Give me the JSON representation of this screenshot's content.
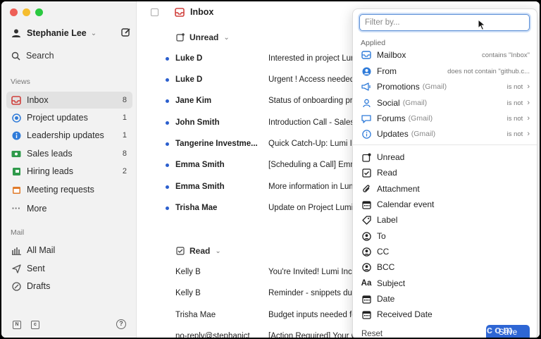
{
  "sidebar": {
    "user_name": "Stephanie Lee",
    "search_label": "Search",
    "views_label": "Views",
    "views": [
      {
        "label": "Inbox",
        "count": "8",
        "icon": "inbox-icon",
        "color": "#d0413d"
      },
      {
        "label": "Project updates",
        "count": "1",
        "icon": "target-icon",
        "color": "#2f7bd9"
      },
      {
        "label": "Leadership updates",
        "count": "1",
        "icon": "info-icon",
        "color": "#2f7bd9"
      },
      {
        "label": "Sales leads",
        "count": "8",
        "icon": "money-icon",
        "color": "#2f9a4b"
      },
      {
        "label": "Hiring leads",
        "count": "2",
        "icon": "flag-icon",
        "color": "#2f9a4b"
      },
      {
        "label": "Meeting requests",
        "count": "",
        "icon": "calendar-icon",
        "color": "#e07b2a"
      },
      {
        "label": "More",
        "count": "",
        "icon": "more-icon",
        "color": "#666666"
      }
    ],
    "mail_label": "Mail",
    "mail": [
      {
        "label": "All Mail",
        "icon": "all-mail-icon"
      },
      {
        "label": "Sent",
        "icon": "send-icon"
      },
      {
        "label": "Drafts",
        "icon": "drafts-icon"
      }
    ]
  },
  "main": {
    "title": "Inbox",
    "unread_group": "Unread",
    "read_group": "Read",
    "unread_rows": [
      {
        "from": "Luke D",
        "subject": "Interested in project Lumi"
      },
      {
        "from": "Luke D",
        "subject": "Urgent ! Access needed"
      },
      {
        "from": "Jane Kim",
        "subject": "Status of onboarding program"
      },
      {
        "from": "John Smith",
        "subject": "Introduction Call - Sales"
      },
      {
        "from": "Tangerine Investme...",
        "subject": "Quick Catch-Up: Lumi Inv"
      },
      {
        "from": "Emma Smith",
        "subject": "[Scheduling a Call] Emma"
      },
      {
        "from": "Emma Smith",
        "subject": "More information in Lumi"
      },
      {
        "from": "Trisha Mae",
        "subject": "Update on Project Lumi"
      }
    ],
    "read_rows": [
      {
        "from": "Kelly B",
        "subject": "You're Invited! Lumi Inc. E"
      },
      {
        "from": "Kelly B",
        "subject": "Reminder - snippets due"
      },
      {
        "from": "Trisha Mae",
        "subject": "Budget inputs needed for"
      },
      {
        "from": "no-reply@stephanict",
        "subject": "[Action Required] Your C"
      }
    ]
  },
  "filter": {
    "placeholder": "Filter by...",
    "applied_label": "Applied",
    "applied": [
      {
        "label": "Mailbox",
        "sub": "",
        "cond": "contains \"Inbox\"",
        "icon": "mailbox-icon",
        "arrow": false
      },
      {
        "label": "From",
        "sub": "",
        "cond": "does not contain \"github.c...",
        "icon": "person-circle-icon",
        "arrow": false
      },
      {
        "label": "Promotions",
        "sub": "(Gmail)",
        "cond": "is not",
        "icon": "megaphone-icon",
        "arrow": true
      },
      {
        "label": "Social",
        "sub": "(Gmail)",
        "cond": "is not",
        "icon": "people-icon",
        "arrow": true
      },
      {
        "label": "Forums",
        "sub": "(Gmail)",
        "cond": "is not",
        "icon": "chat-icon",
        "arrow": true
      },
      {
        "label": "Updates",
        "sub": "(Gmail)",
        "cond": "is not",
        "icon": "info-circle-icon",
        "arrow": true
      }
    ],
    "options": [
      {
        "label": "Unread",
        "icon": "unread-icon"
      },
      {
        "label": "Read",
        "icon": "checkbox-icon"
      },
      {
        "label": "Attachment",
        "icon": "paperclip-icon"
      },
      {
        "label": "Calendar event",
        "icon": "calendar-icon"
      },
      {
        "label": "Label",
        "icon": "tag-icon"
      },
      {
        "label": "To",
        "icon": "person-circle-icon"
      },
      {
        "label": "CC",
        "icon": "person-circle-icon"
      },
      {
        "label": "BCC",
        "icon": "person-circle-icon"
      },
      {
        "label": "Subject",
        "icon": "text-aa-icon"
      },
      {
        "label": "Date",
        "icon": "calendar-icon"
      },
      {
        "label": "Received Date",
        "icon": "calendar-icon"
      }
    ],
    "reset_label": "Reset",
    "save_label": "Save"
  },
  "watermark": "www.cbsh.com",
  "colors": {
    "accent": "#2e66d4",
    "applied_icon": "#2f7bd9"
  }
}
